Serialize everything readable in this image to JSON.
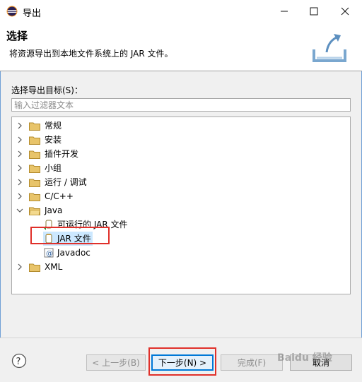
{
  "window": {
    "title": "导出"
  },
  "header": {
    "title": "选择",
    "description": "将资源导出到本地文件系统上的 JAR 文件。"
  },
  "destination": {
    "label": "选择导出目标(S)：",
    "filter_placeholder": "输入过滤器文本"
  },
  "tree": {
    "items": [
      {
        "label": "常规",
        "expanded": false
      },
      {
        "label": "安装",
        "expanded": false
      },
      {
        "label": "插件开发",
        "expanded": false
      },
      {
        "label": "小组",
        "expanded": false
      },
      {
        "label": "运行 / 调试",
        "expanded": false
      },
      {
        "label": "C/C++",
        "expanded": false
      },
      {
        "label": "Java",
        "expanded": true,
        "children": [
          {
            "label": "可运行的 JAR 文件"
          },
          {
            "label": "JAR 文件",
            "selected": true
          },
          {
            "label": "Javadoc"
          }
        ]
      },
      {
        "label": "XML",
        "expanded": false
      }
    ]
  },
  "buttons": {
    "back": "< 上一步(B)",
    "next": "下一步(N) >",
    "finish": "完成(F)",
    "cancel": "取消"
  },
  "watermark": "Baidu 经验",
  "colors": {
    "folder": "#e8c46a",
    "highlight": "#e0302a",
    "selection": "#cce8ff",
    "default_button": "#0078d7"
  }
}
